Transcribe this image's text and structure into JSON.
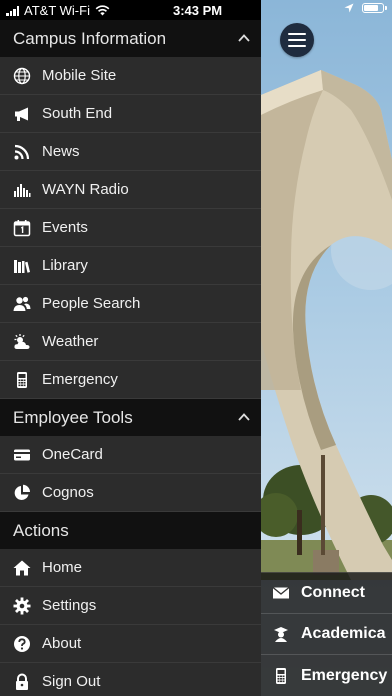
{
  "status_bar": {
    "carrier": "AT&T Wi-Fi",
    "time": "3:43 PM",
    "battery_level": 0.85
  },
  "drawer": {
    "sections": [
      {
        "title": "Campus Information",
        "collapsible": true,
        "items": [
          {
            "label": "Mobile Site",
            "icon": "globe-icon"
          },
          {
            "label": "South End",
            "icon": "megaphone-icon"
          },
          {
            "label": "News",
            "icon": "rss-icon"
          },
          {
            "label": "WAYN Radio",
            "icon": "equalizer-icon"
          },
          {
            "label": "Events",
            "icon": "calendar-icon"
          },
          {
            "label": "Library",
            "icon": "books-icon"
          },
          {
            "label": "People Search",
            "icon": "people-icon"
          },
          {
            "label": "Weather",
            "icon": "weather-icon"
          },
          {
            "label": "Emergency",
            "icon": "phone-icon"
          }
        ]
      },
      {
        "title": "Employee Tools",
        "collapsible": true,
        "items": [
          {
            "label": "OneCard",
            "icon": "card-icon"
          },
          {
            "label": "Cognos",
            "icon": "pie-chart-icon"
          }
        ]
      },
      {
        "title": "Actions",
        "collapsible": false,
        "items": [
          {
            "label": "Home",
            "icon": "home-icon"
          },
          {
            "label": "Settings",
            "icon": "gear-icon"
          },
          {
            "label": "About",
            "icon": "question-icon"
          },
          {
            "label": "Sign Out",
            "icon": "lock-icon"
          }
        ]
      }
    ]
  },
  "quick_links": [
    {
      "label": "Connect",
      "icon": "envelope-icon"
    },
    {
      "label": "Academica",
      "icon": "graduate-icon"
    },
    {
      "label": "Emergency",
      "icon": "phone-icon"
    }
  ],
  "colors": {
    "drawer_bg": "#2c2c2c",
    "section_header_bg": "#111111",
    "menu_button_bg": "#1f2c3f"
  }
}
